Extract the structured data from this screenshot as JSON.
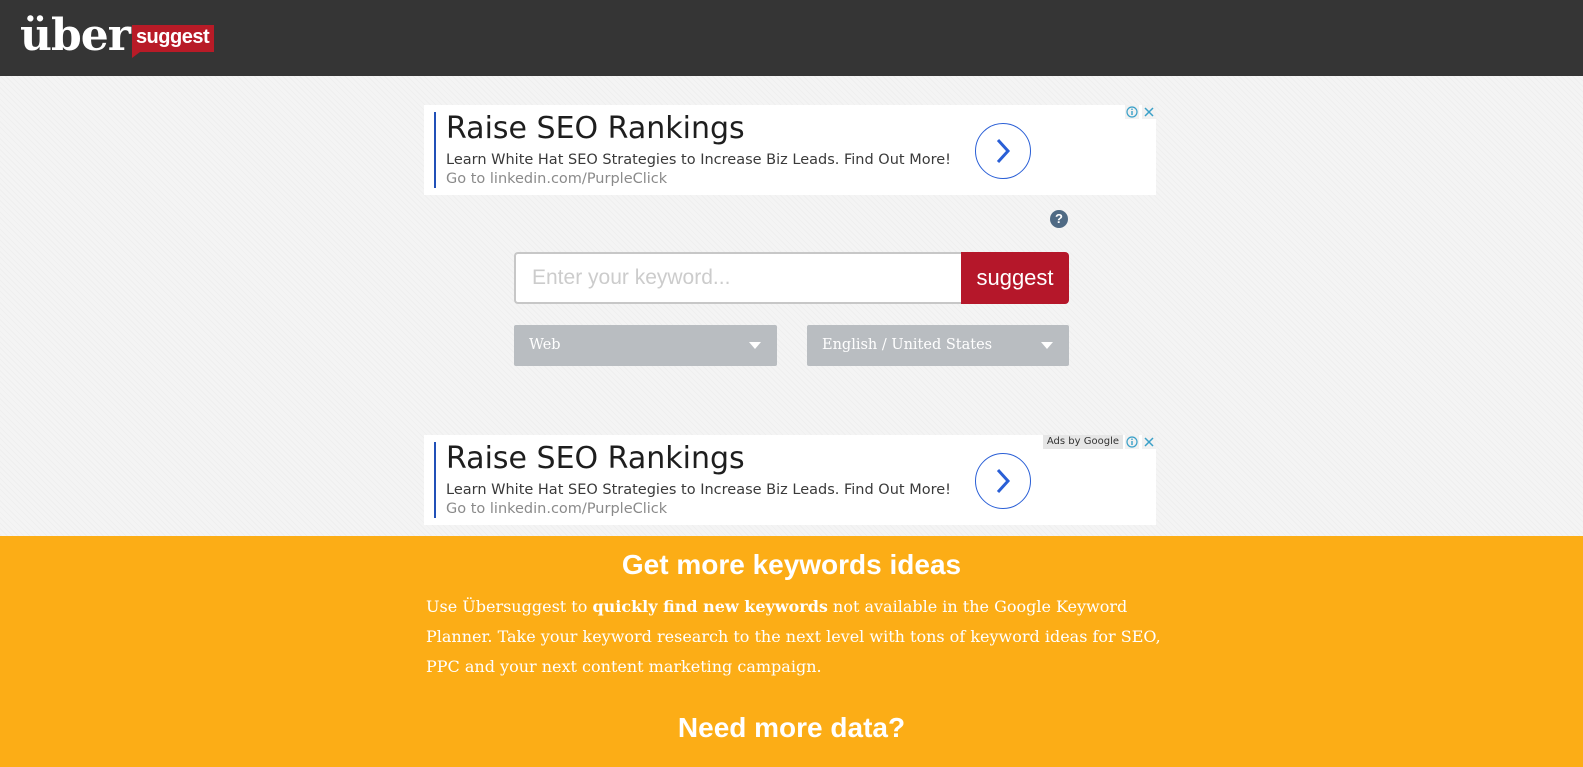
{
  "header": {
    "logo_uber": "über",
    "logo_suggest": "suggest",
    "bg_color": "#353535"
  },
  "ads": [
    {
      "title": "Raise SEO Rankings",
      "description": "Learn White Hat SEO Strategies to Increase Biz Leads. Find Out More!",
      "url_text": "Go to linkedin.com/PurpleClick",
      "show_ads_by": false
    },
    {
      "title": "Raise SEO Rankings",
      "description": "Learn White Hat SEO Strategies to Increase Biz Leads. Find Out More!",
      "url_text": "Go to linkedin.com/PurpleClick",
      "ads_by_label": "Ads by Google",
      "show_ads_by": true
    }
  ],
  "search": {
    "placeholder": "Enter your keyword...",
    "value": "",
    "button_label": "suggest",
    "help_label": "?"
  },
  "filters": {
    "source_selected": "Web",
    "language_selected": "English / United States"
  },
  "promo": {
    "title": "Get more keywords ideas",
    "text_before": "Use Übersuggest to ",
    "text_bold": "quickly find new keywords",
    "text_after": " not available in the Google Keyword Planner. Take your keyword research to the next level with tons of keyword ideas for SEO, PPC and your next content marketing campaign.",
    "subtitle": "Need more data?",
    "bg_color": "#fcad16"
  },
  "colors": {
    "accent_red": "#b5172a",
    "select_gray": "#b9bdc1",
    "ad_blue": "#2150b8"
  }
}
